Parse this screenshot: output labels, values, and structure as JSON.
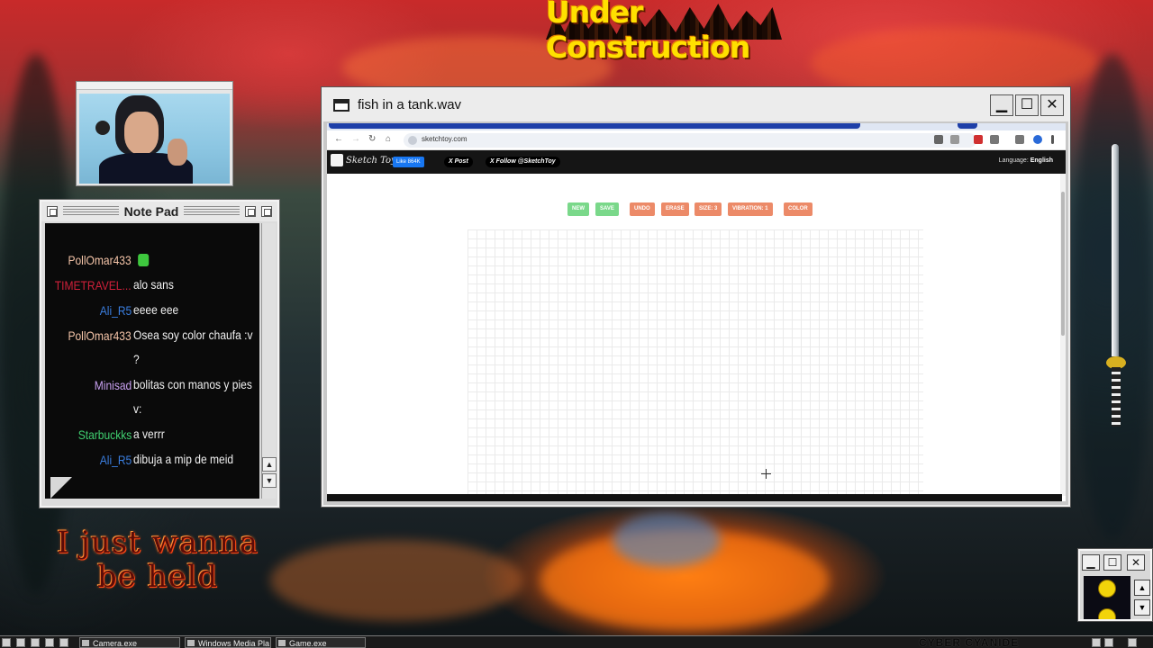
{
  "banner": {
    "text": "Under Construction"
  },
  "overlay_text": {
    "line1": "I just wanna",
    "line2": "be held"
  },
  "notepad": {
    "title": "Note Pad",
    "messages": [
      {
        "user": "PollOmar433",
        "user_color": "#f4c4a8",
        "text": "",
        "emote": true
      },
      {
        "user": "TIMETRAVEL...",
        "user_color": "#d0203a",
        "text": "alo sans"
      },
      {
        "user": "Ali_R5",
        "user_color": "#3a7ee0",
        "text": "eeee eee"
      },
      {
        "user": "PollOmar433",
        "user_color": "#f4c4a8",
        "text": "Osea soy color chaufa :v",
        "text2": "?"
      },
      {
        "user": "Minisad",
        "user_color": "#c8a0f0",
        "text": "bolitas con manos y pies",
        "text2": "v:"
      },
      {
        "user": "Starbuckks",
        "user_color": "#40d070",
        "text": "a verrr"
      },
      {
        "user": "Ali_R5",
        "user_color": "#3a7ee0",
        "text": "dibuja a mip de meid"
      }
    ]
  },
  "window": {
    "title": "fish in a tank.wav",
    "controls": {
      "minimize": "▁",
      "maximize": "☐",
      "close": "✕"
    }
  },
  "browser": {
    "url": "sketchtoy.com",
    "site": {
      "logo": "Sketch Toy",
      "fb_like": "Like 864K",
      "x_post": "X Post",
      "x_follow": "X Follow @SketchToy",
      "language_label": "Language:",
      "language_value": "English"
    },
    "tools": [
      {
        "label": "NEW",
        "color": "#7ad88a"
      },
      {
        "label": "SAVE",
        "color": "#7ad88a"
      },
      {
        "label": "UNDO",
        "color": "#ec8a68"
      },
      {
        "label": "ERASE",
        "color": "#ec8a68"
      },
      {
        "label": "SIZE: 3",
        "color": "#ec8a68"
      },
      {
        "label": "VIBRATION: 1",
        "color": "#ec8a68"
      },
      {
        "label": "COLOR",
        "color": "#ec8a68"
      }
    ]
  },
  "taskbar": {
    "tasks": [
      "Camera.exe",
      "Windows Media Pla",
      "Game.exe"
    ],
    "brand": "CYBER CYANIDE"
  },
  "icons": [
    "window-icon",
    "back-icon",
    "forward-icon",
    "reload-icon",
    "home-icon",
    "crosshair-icon",
    "smiley-icon",
    "katana-icon"
  ]
}
